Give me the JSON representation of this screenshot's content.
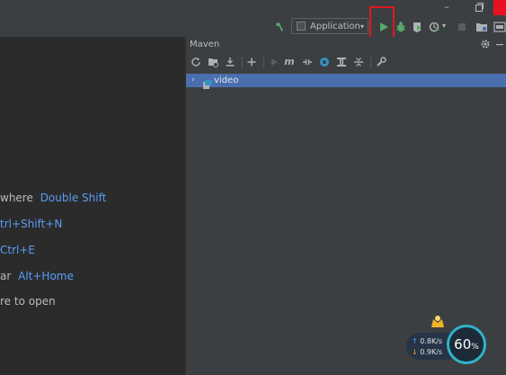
{
  "toolbar": {
    "run_config": "Application",
    "dropdown_arrow": "▾"
  },
  "editor": {
    "hints": [
      {
        "text": "where",
        "key": "Double Shift"
      },
      {
        "text": "",
        "key": "trl+Shift+N"
      },
      {
        "text": "",
        "key": "Ctrl+E"
      },
      {
        "text": "ar",
        "key": "Alt+Home"
      },
      {
        "text": "re to open",
        "key": ""
      }
    ]
  },
  "maven": {
    "title": "Maven",
    "tree": [
      {
        "label": "video",
        "expanded": false
      }
    ]
  },
  "widget": {
    "upload": "0.8",
    "upload_unit": "K/s",
    "download": "0.9",
    "download_unit": "K/s",
    "percent": "60",
    "percent_sign": "%"
  },
  "colors": {
    "run_green": "#59a869",
    "highlight_red": "#e0191f",
    "selection_blue": "#4b6eaf",
    "shortcut_blue": "#589df6"
  }
}
